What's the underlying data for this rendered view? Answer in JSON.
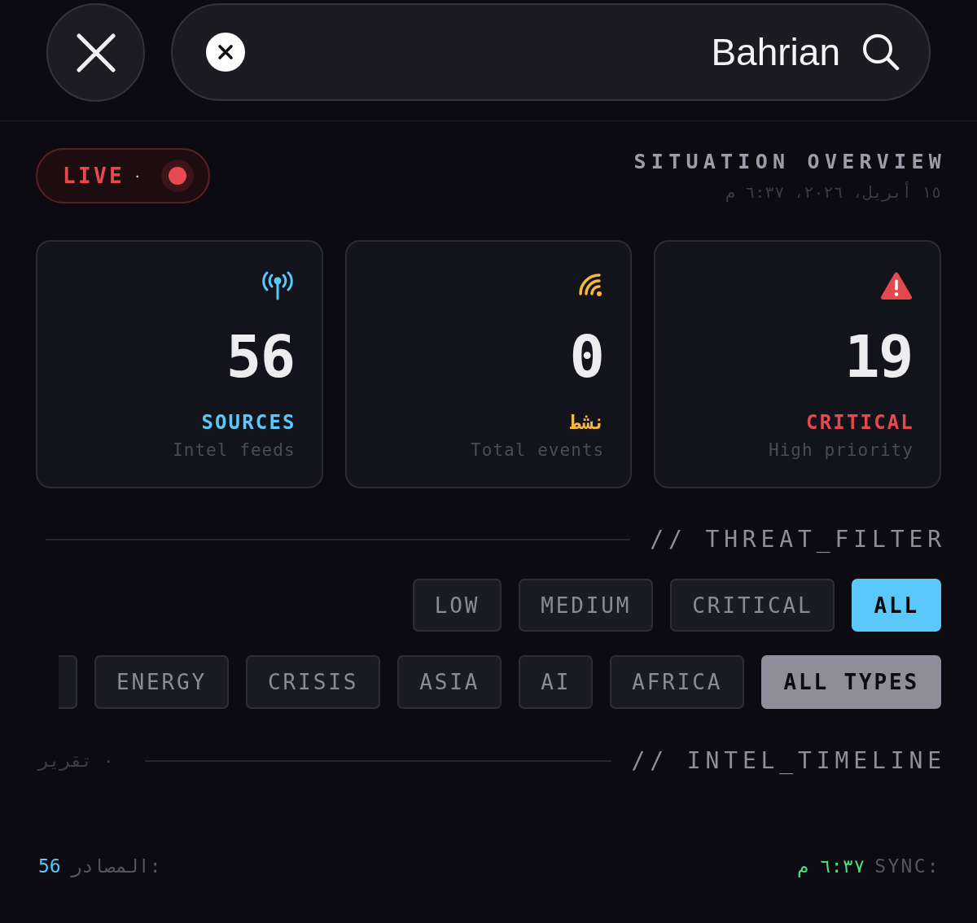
{
  "search": {
    "value": "Bahrian"
  },
  "header": {
    "live": {
      "label": "LIVE",
      "count": "٠"
    },
    "title": "SITUATION OVERVIEW",
    "timestamp": "١٥ أبريل، ٢٠٢٦، ٦:٣٧ م"
  },
  "stats": [
    {
      "kind": "sources",
      "value": "56",
      "label": "SOURCES",
      "caption": "Intel feeds",
      "color": "#5ac8fa"
    },
    {
      "kind": "activity",
      "value": "0",
      "label": "نشط",
      "caption": "Total events",
      "color": "#f5b83d"
    },
    {
      "kind": "alert",
      "value": "19",
      "label": "CRITICAL",
      "caption": "High priority",
      "color": "#e5484d"
    }
  ],
  "threat_filter": {
    "title": "// THREAT_FILTER",
    "options": [
      {
        "label": "LOW",
        "selected": false
      },
      {
        "label": "MEDIUM",
        "selected": false
      },
      {
        "label": "CRITICAL",
        "selected": false
      },
      {
        "label": "ALL",
        "selected": true
      }
    ]
  },
  "type_filter": {
    "options": [
      {
        "label": "ENERGY",
        "selected": false
      },
      {
        "label": "CRISIS",
        "selected": false
      },
      {
        "label": "ASIA",
        "selected": false
      },
      {
        "label": "AI",
        "selected": false
      },
      {
        "label": "AFRICA",
        "selected": false
      },
      {
        "label": "ALL TYPES",
        "selected": true
      }
    ]
  },
  "timeline": {
    "title": "// INTEL_TIMELINE",
    "count": "٠ تقرير"
  },
  "status_bar": {
    "sources_label": "المصادر:",
    "sources_value": "56",
    "sync_label": "SYNC:",
    "sync_time": "٦:٣٧ م"
  }
}
